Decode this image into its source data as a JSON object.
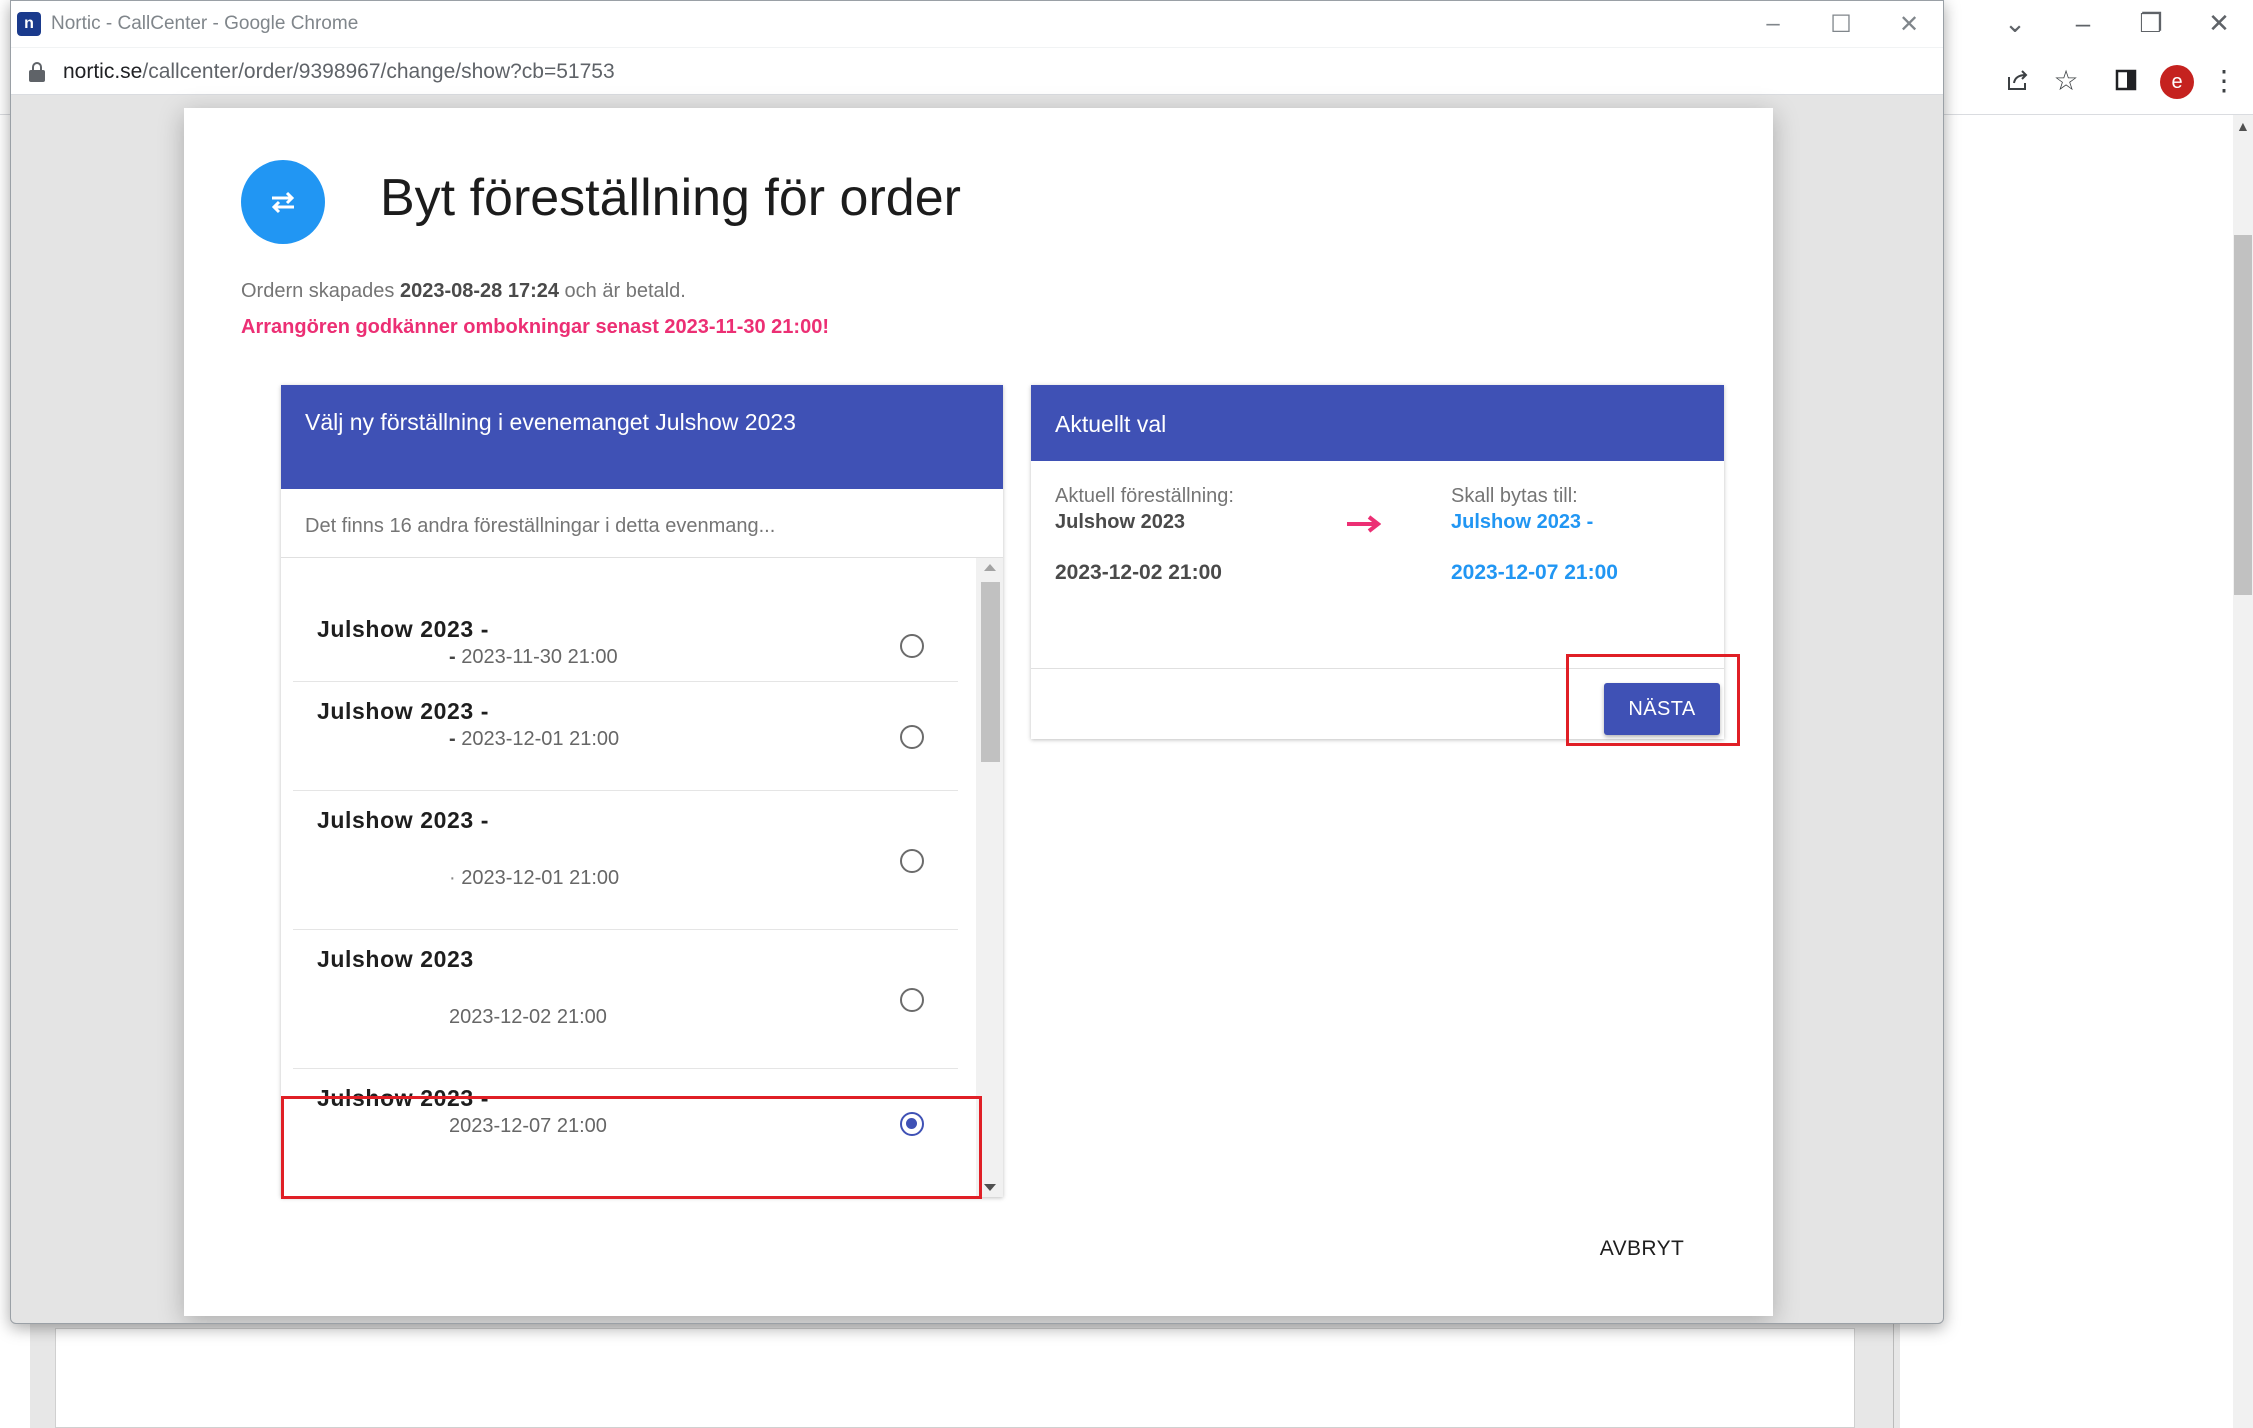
{
  "browser_main": {
    "avatar_letter": "e"
  },
  "popup": {
    "window_title": "Nortic - CallCenter - Google Chrome",
    "favicon_letter": "n",
    "url_host": "nortic.se",
    "url_path": "/callcenter/order/9398967/change/show?cb=51753"
  },
  "dialog": {
    "title": "Byt föreställning för order",
    "order_info_prefix": "Ordern skapades ",
    "order_created": "2023-08-28 17:24",
    "order_info_suffix": " och är betald.",
    "warning": "Arrangören godkänner ombokningar senast 2023-11-30 21:00!",
    "left_panel": {
      "header": "Välj ny förställning i evenemanget Julshow 2023",
      "subtitle": "Det finns 16 andra föreställningar i detta evenmang...",
      "performances": [
        {
          "name": "Julshow 2023 -",
          "date": "2023-11-30 21:00",
          "selected": false
        },
        {
          "name": "Julshow 2023 -",
          "date": "2023-12-01 21:00",
          "selected": false
        },
        {
          "name": "Julshow 2023 -",
          "date": "2023-12-01 21:00",
          "selected": false
        },
        {
          "name": "Julshow 2023",
          "date": "2023-12-02 21:00",
          "selected": false
        },
        {
          "name": "Julshow 2023 -",
          "date": "2023-12-07 21:00",
          "selected": true
        }
      ]
    },
    "right_panel": {
      "header": "Aktuellt val",
      "current_label": "Aktuell föreställning:",
      "current_name": "Julshow 2023",
      "current_date": "2023-12-02 21:00",
      "new_label": "Skall bytas till:",
      "new_name": "Julshow 2023 -",
      "new_date": "2023-12-07 21:00",
      "next_button": "NÄSTA"
    },
    "cancel_button": "AVBRYT"
  },
  "colors": {
    "primary": "#3f51b5",
    "accent_blue": "#2196f3",
    "warning_pink": "#ec2f74",
    "highlight_red": "#e01f26"
  }
}
